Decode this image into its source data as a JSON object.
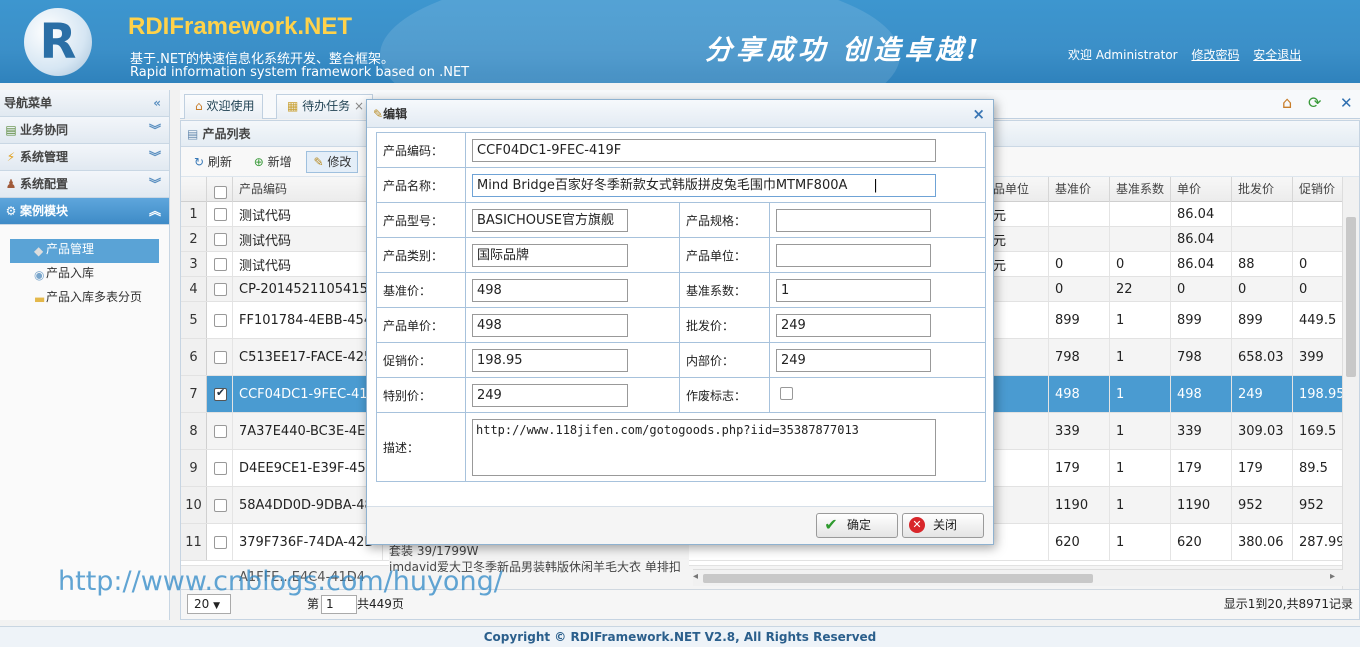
{
  "header": {
    "logo_letter": "R",
    "title": "RDIFramework.NET",
    "subtitle_cn": "基于.NET的快速信息化系统开发、整合框架。",
    "subtitle_en": "Rapid information system framework based on .NET",
    "slogan": "分享成功 创造卓越!",
    "welcome": "欢迎 Administrator",
    "change_password": "修改密码",
    "logout": "安全退出"
  },
  "sidebar": {
    "title": "导航菜单",
    "groups": [
      {
        "label": "业务协同"
      },
      {
        "label": "系统管理"
      },
      {
        "label": "系统配置"
      },
      {
        "label": "案例模块"
      }
    ],
    "items": [
      {
        "label": "产品管理"
      },
      {
        "label": "产品入库"
      },
      {
        "label": "产品入库多表分页"
      }
    ]
  },
  "tabs": [
    {
      "label": "欢迎使用"
    },
    {
      "label": "待办任务"
    }
  ],
  "panel": {
    "title": "产品列表",
    "toolbar": {
      "refresh": "刷新",
      "add": "新增",
      "edit": "修改"
    }
  },
  "grid": {
    "columns": [
      "产品编码",
      "品单位",
      "基准价",
      "基准系数",
      "单价",
      "批发价",
      "促销价"
    ],
    "rows": [
      {
        "n": "1",
        "code": "测试代码",
        "unit": "元",
        "base": "",
        "coef": "",
        "price": "86.04",
        "whole": "",
        "promo": ""
      },
      {
        "n": "2",
        "code": "测试代码",
        "unit": "元",
        "base": "",
        "coef": "",
        "price": "86.04",
        "whole": "",
        "promo": ""
      },
      {
        "n": "3",
        "code": "测试代码",
        "unit": "元",
        "base": "0",
        "coef": "0",
        "price": "86.04",
        "whole": "88",
        "promo": "0"
      },
      {
        "n": "4",
        "code": "CP-2014521105415",
        "unit": "",
        "base": "0",
        "coef": "22",
        "price": "0",
        "whole": "0",
        "promo": "0"
      },
      {
        "n": "5",
        "code": "FF101784-4EBB-454",
        "unit": "",
        "base": "899",
        "coef": "1",
        "price": "899",
        "whole": "899",
        "promo": "449.5"
      },
      {
        "n": "6",
        "code": "C513EE17-FACE-425",
        "unit": "",
        "base": "798",
        "coef": "1",
        "price": "798",
        "whole": "658.03",
        "promo": "399"
      },
      {
        "n": "7",
        "code": "CCF04DC1-9FEC-41",
        "unit": "",
        "base": "498",
        "coef": "1",
        "price": "498",
        "whole": "249",
        "promo": "198.95"
      },
      {
        "n": "8",
        "code": "7A37E440-BC3E-4E7",
        "unit": "",
        "base": "339",
        "coef": "1",
        "price": "339",
        "whole": "309.03",
        "promo": "169.5"
      },
      {
        "n": "9",
        "code": "D4EE9CE1-E39F-45E",
        "unit": "",
        "base": "179",
        "coef": "1",
        "price": "179",
        "whole": "179",
        "promo": "89.5"
      },
      {
        "n": "10",
        "code": "58A4DD0D-9DBA-48",
        "unit": "",
        "base": "1190",
        "coef": "1",
        "price": "1190",
        "whole": "952",
        "promo": "952"
      },
      {
        "n": "11",
        "code": "379F736F-74DA-42D",
        "unit": "",
        "base": "620",
        "coef": "1",
        "price": "620",
        "whole": "380.06",
        "promo": "287.99"
      }
    ],
    "row11_note1": "套装 39/1799W",
    "row11_note2": "imdavid爱大卫冬季新品男装韩版休闲羊毛大衣 单排扣",
    "row12_partial": "A1FFE...E4C4-41D4"
  },
  "pager": {
    "page_size": "20",
    "page_label": "第",
    "page_value": "1",
    "total_pages": "共449页",
    "summary": "显示1到20,共8971记录"
  },
  "watermark": "http://www.cnblogs.com/huyong/",
  "footer": "Copyright © RDIFramework.NET V2.8, All Rights Reserved",
  "dialog": {
    "title": "编辑",
    "labels": {
      "code": "产品编码：",
      "name": "产品名称：",
      "model": "产品型号：",
      "spec": "产品规格：",
      "category": "产品类别：",
      "unit": "产品单位：",
      "base_price": "基准价：",
      "base_coef": "基准系数：",
      "unit_price": "产品单价：",
      "wholesale": "批发价：",
      "promo": "促销价：",
      "internal": "内部价：",
      "special": "特别价：",
      "obsolete": "作废标志：",
      "desc": "描述："
    },
    "values": {
      "code": "CCF04DC1-9FEC-419F",
      "name": "Mind Bridge百家好冬季新款女式韩版拼皮兔毛围巾MTMF800A",
      "model": "BASICHOUSE官方旗舰",
      "spec": "",
      "category": "国际品牌",
      "unit": "",
      "base_price": "498",
      "base_coef": "1",
      "unit_price": "498",
      "wholesale": "249",
      "promo": "198.95",
      "internal": "249",
      "special": "249",
      "desc": "http://www.118jifen.com/gotogoods.php?iid=35387877013"
    },
    "ok": "确定",
    "close": "关闭"
  },
  "colors": {
    "header": "#3b8fc8",
    "accent": "#4a9bd1",
    "title_yellow": "#ffd24a"
  }
}
